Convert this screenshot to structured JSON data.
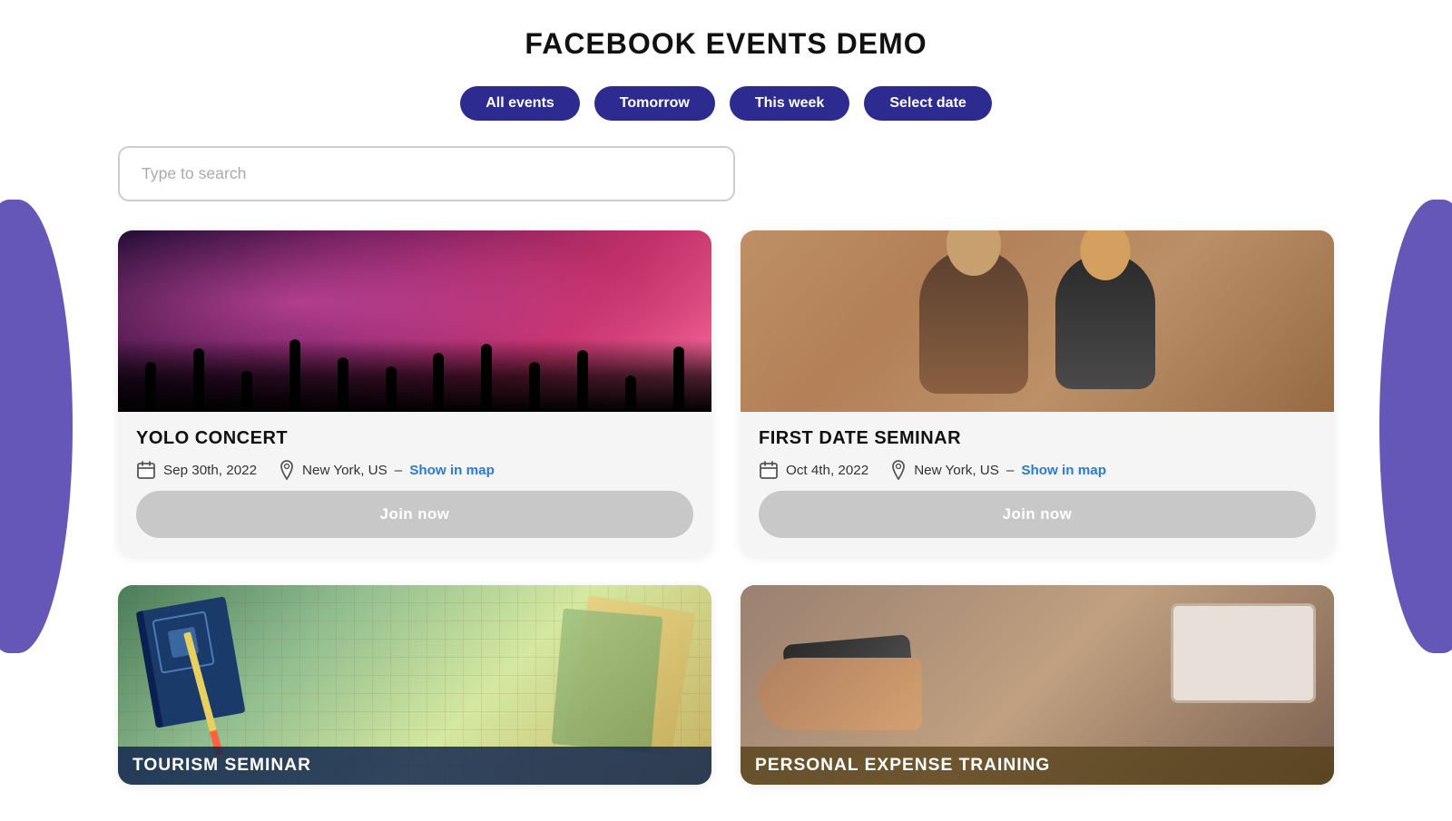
{
  "page": {
    "title": "FACEBOOK EVENTS DEMO"
  },
  "filters": {
    "all_events": "All events",
    "tomorrow": "Tomorrow",
    "this_week": "This week",
    "select_date": "Select date"
  },
  "search": {
    "placeholder": "Type to search"
  },
  "events": [
    {
      "id": "yolo-concert",
      "title": "YOLO CONCERT",
      "date": "Sep 30th, 2022",
      "location": "New York, US",
      "show_in_map": "Show in map",
      "join_label": "Join now",
      "image_type": "concert"
    },
    {
      "id": "first-date-seminar",
      "title": "FIRST DATE SEMINAR",
      "date": "Oct 4th, 2022",
      "location": "New York, US",
      "show_in_map": "Show in map",
      "join_label": "Join now",
      "image_type": "date"
    },
    {
      "id": "tourism-seminar",
      "title": "TOURISM SEMINAR",
      "date": "",
      "location": "",
      "show_in_map": "",
      "join_label": "",
      "image_type": "tourism"
    },
    {
      "id": "personal-expense-training",
      "title": "PERSONAL EXPENSE TRAINING",
      "date": "",
      "location": "",
      "show_in_map": "",
      "join_label": "",
      "image_type": "expense"
    }
  ],
  "colors": {
    "accent": "#2d2b8f",
    "link": "#2a7bd4",
    "button_bg": "#c8c8c8"
  }
}
